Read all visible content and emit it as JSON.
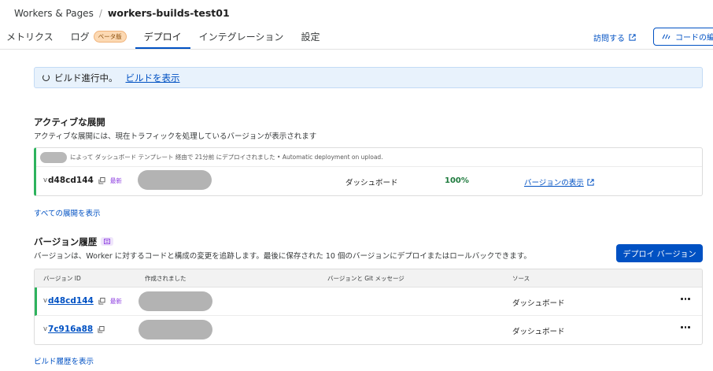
{
  "breadcrumb": {
    "parent": "Workers & Pages",
    "separator": "/",
    "current": "workers-builds-test01"
  },
  "tabs": [
    {
      "label": "メトリクス"
    },
    {
      "label": "ログ",
      "badge": "ベータ版"
    },
    {
      "label": "デプロイ",
      "active": true
    },
    {
      "label": "インテグレーション"
    },
    {
      "label": "設定"
    }
  ],
  "header_actions": {
    "visit_label": "訪問する",
    "code_edit_label": "コードの編集"
  },
  "build_banner": {
    "text": "ビルド進行中。",
    "link": "ビルドを表示"
  },
  "active_deployment": {
    "title": "アクティブな展開",
    "description": "アクティブな展開には、現在トラフィックを処理しているバージョンが表示されます",
    "meta": "によって ダッシュボード テンプレート 経由で 21分前 にデプロイされました • Automatic deployment on upload.",
    "version_prefix": "v",
    "version_id": "d48cd144",
    "latest_label": "最新",
    "source": "ダッシュボード",
    "percent": "100%",
    "view_version_label": "バージョンの表示"
  },
  "show_all_deployments": "すべての展開を表示",
  "version_history": {
    "title": "バージョン履歴",
    "description": "バージョンは、Worker に対するコードと構成の変更を追跡します。最後に保存された 10 個のバージョンにデプロイまたはロールバックできます。",
    "deploy_button": "デプロイ バージョン",
    "columns": [
      "バージョン ID",
      "作成されました",
      "バージョンと Git メッセージ",
      "ソース"
    ],
    "rows": [
      {
        "prefix": "v",
        "id": "d48cd144",
        "latest": "最新",
        "source": "ダッシュボード"
      },
      {
        "prefix": "v",
        "id": "7c916a88",
        "latest": "",
        "source": "ダッシュボード"
      }
    ]
  },
  "show_build_history": "ビルド履歴を表示",
  "colors": {
    "accent": "#0051c3",
    "active_green": "#2db35d",
    "banner_bg": "#e8f2fc"
  }
}
